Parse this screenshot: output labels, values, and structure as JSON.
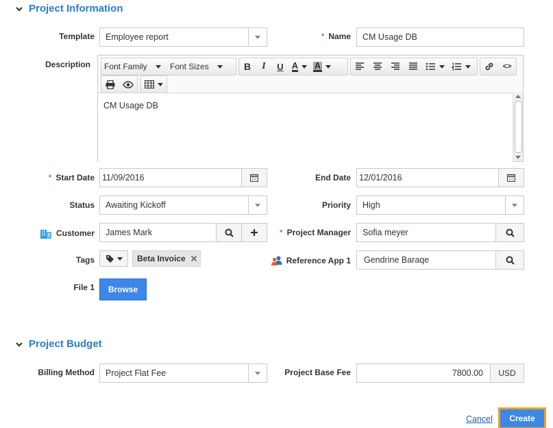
{
  "sections": {
    "project_information": "Project Information",
    "project_budget": "Project Budget"
  },
  "labels": {
    "template": "Template",
    "name": "Name",
    "description": "Description",
    "start_date": "Start Date",
    "end_date": "End Date",
    "status": "Status",
    "priority": "Priority",
    "customer": "Customer",
    "project_manager": "Project Manager",
    "tags": "Tags",
    "reference_app": "Reference App 1",
    "file": "File 1",
    "billing_method": "Billing Method",
    "project_base_fee": "Project Base Fee"
  },
  "required_marker": "*",
  "values": {
    "template": "Employee report",
    "name": "CM Usage DB",
    "description": "CM Usage DB",
    "start_date": "11/09/2016",
    "end_date": "12/01/2016",
    "status": "Awaiting Kickoff",
    "priority": "High",
    "customer": "James Mark",
    "project_manager": "Sofia meyer",
    "reference_app": "Gendrine Baraqe",
    "billing_method": "Project Flat Fee",
    "project_base_fee": "7800.00",
    "currency": "USD"
  },
  "editor_toolbar": {
    "font_family": "Font Family",
    "font_sizes": "Font Sizes",
    "bold": "B",
    "italic": "I",
    "underline": "U",
    "text_color": "A",
    "bg_color": "A",
    "source_code": "<>"
  },
  "tags": [
    "Beta Invoice"
  ],
  "buttons": {
    "browse": "Browse",
    "cancel": "Cancel",
    "create": "Create"
  },
  "colors": {
    "accent": "#2a7bd3",
    "primary_button": "#3d87e8",
    "focus_outline": "#f0a020",
    "required": "#d9232d"
  }
}
